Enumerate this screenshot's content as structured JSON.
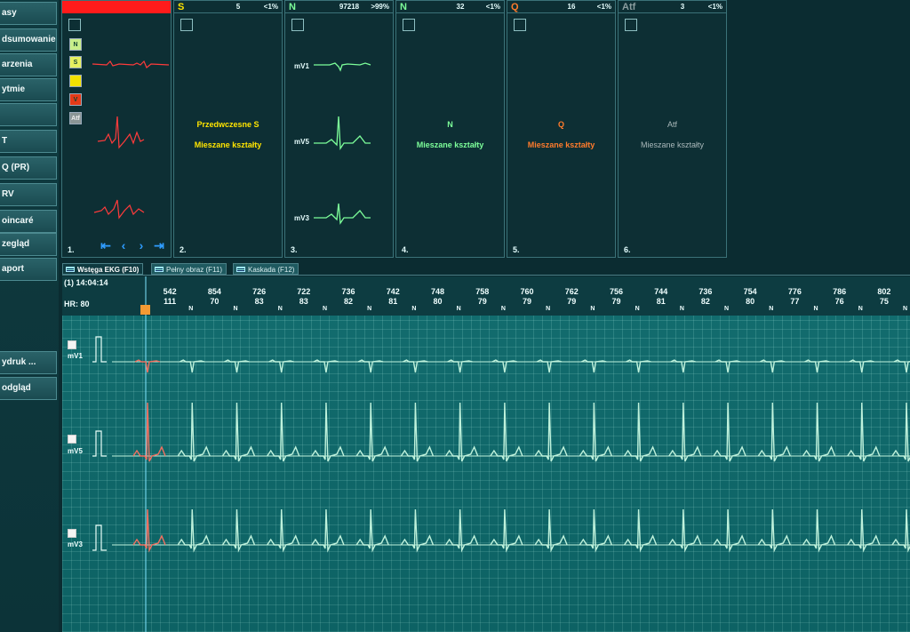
{
  "sidebar": {
    "items": [
      {
        "label": "asy"
      },
      {
        "label": "dsumowanie"
      },
      {
        "label": "arzenia"
      },
      {
        "label": "ytmie"
      },
      {
        "label": ""
      },
      {
        "label": "T"
      },
      {
        "label": "Q (PR)"
      },
      {
        "label": "RV"
      },
      {
        "label": "oincaré"
      },
      {
        "label": "zegląd"
      },
      {
        "label": "aport"
      },
      {
        "label": "ydruk ..."
      },
      {
        "label": "odgląd"
      }
    ]
  },
  "panels": [
    {
      "number": "1.",
      "class_buttons": [
        {
          "label": "N",
          "color": "#c8ef8a"
        },
        {
          "label": "S",
          "color": "#e6f060"
        },
        {
          "label": "",
          "color": "#f3e200"
        },
        {
          "label": "V",
          "color": "#e33a18"
        },
        {
          "label": "Atf",
          "color": "#8a9595"
        }
      ]
    },
    {
      "label": "S",
      "count": "5",
      "pct": "<1%",
      "color": "#ffe400",
      "number": "2.",
      "lines": [
        "Przedwczesne S",
        "Mieszane kształty"
      ]
    },
    {
      "label": "N",
      "count": "97218",
      "pct": ">99%",
      "color": "#7dff9a",
      "number": "3.",
      "leads": [
        "mV1",
        "mV5",
        "mV3"
      ]
    },
    {
      "label": "N",
      "count": "32",
      "pct": "<1%",
      "color": "#7dff9a",
      "number": "4.",
      "lines": [
        "N",
        "Mieszane kształty"
      ]
    },
    {
      "label": "Q",
      "count": "16",
      "pct": "<1%",
      "color": "#ff7b2c",
      "number": "5.",
      "lines": [
        "Q",
        "Mieszane kształty"
      ]
    },
    {
      "label": "Atf",
      "count": "3",
      "pct": "<1%",
      "color": "#8b9d9f",
      "number": "6.",
      "lines": [
        "Atf",
        "Mieszane kształty"
      ]
    }
  ],
  "tabs": [
    {
      "label": "Wstęga EKG (F10)"
    },
    {
      "label": "Pełny obraz (F11)"
    },
    {
      "label": "Kaskada (F12)"
    }
  ],
  "ecg": {
    "time": "(1) 14:04:14",
    "hr": "HR: 80",
    "rr_intervals": [
      "542",
      "854",
      "726",
      "722",
      "736",
      "742",
      "748",
      "758",
      "760",
      "762",
      "756",
      "744",
      "736",
      "754",
      "776",
      "786",
      "802"
    ],
    "hr_values": [
      "111",
      "70",
      "83",
      "83",
      "82",
      "81",
      "80",
      "79",
      "79",
      "79",
      "79",
      "81",
      "82",
      "80",
      "77",
      "76",
      "75"
    ],
    "beat_labels": [
      "N",
      "N",
      "N",
      "N",
      "N",
      "N",
      "N",
      "N",
      "N",
      "N",
      "N",
      "N",
      "N",
      "N",
      "N",
      "N",
      "N",
      "N"
    ],
    "leads": [
      "mV1",
      "mV5",
      "mV3"
    ],
    "trace_color": "#bff2dc",
    "highlight_color": "#f07060"
  }
}
